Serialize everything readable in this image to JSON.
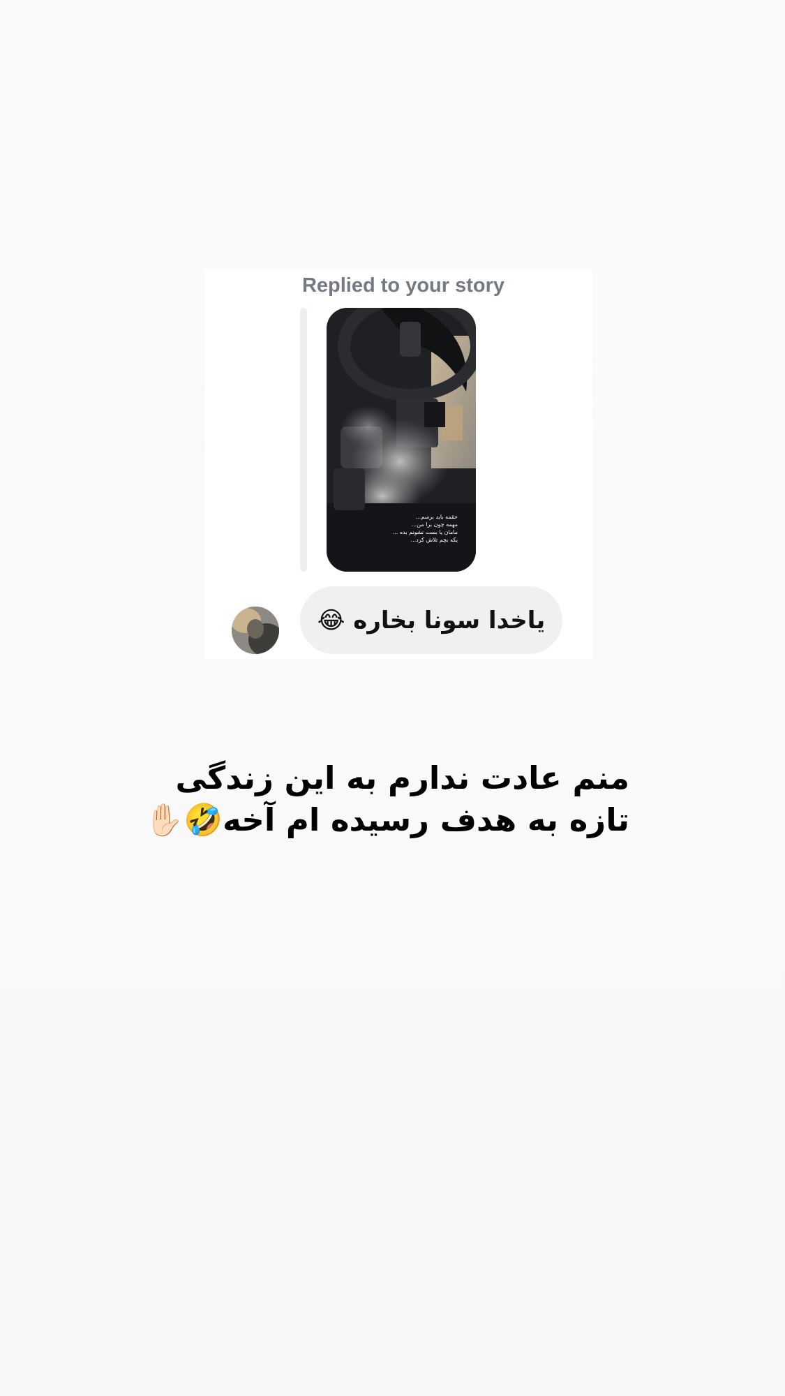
{
  "story_reply": {
    "label": "Replied to your story",
    "story_caption": [
      "حقمه باید برسم...",
      "مهمه چون برا من...",
      "مامان یا بست نشونم بده ...",
      "یکه بچم تلاش کرد..."
    ],
    "message": "یاخدا سونا بخاره 😂"
  },
  "overlay": {
    "lines": [
      "منم عادت ندارم به این زندگی",
      "تازه به هدف رسیده ام آخه🤣✋🏻"
    ]
  },
  "colors": {
    "background": "#fafafa",
    "card": "#ffffff",
    "label": "#737a85",
    "bubble": "#eff0f2",
    "reply_bar": "#eceff2",
    "text": "#000000"
  },
  "icons": {
    "story": "story-thumbnail-image",
    "avatar": "user-avatar-image"
  }
}
